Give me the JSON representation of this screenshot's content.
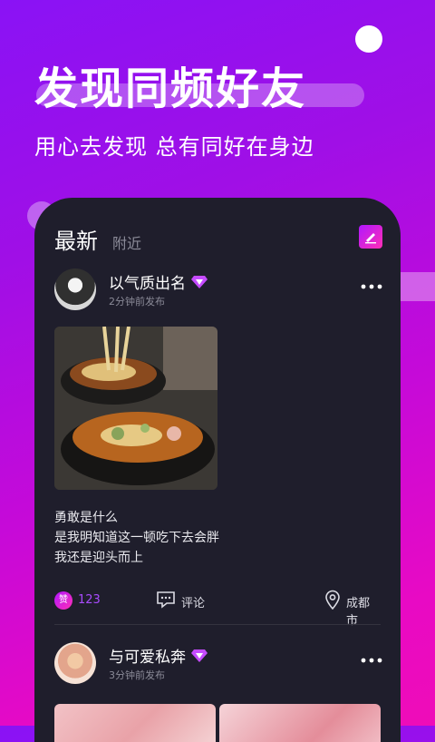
{
  "banner": {
    "headline": "发现同频好友",
    "subline": "用心去发现 总有同好在身边"
  },
  "tabs": [
    {
      "label": "最新",
      "active": true
    },
    {
      "label": "附近",
      "active": false
    }
  ],
  "posts": [
    {
      "username": "以气质出名",
      "time": "2分钟前发布",
      "text": [
        "勇敢是什么",
        "是我明知道这一顿吃下去会胖",
        "我还是迎头而上"
      ],
      "like_badge": "赞",
      "likes": "123",
      "comment_label": "评论",
      "location": "成都市"
    },
    {
      "username": "与可爱私奔",
      "time": "3分钟前发布"
    }
  ],
  "icons": {
    "edit": "edit-icon",
    "vip": "diamond-icon",
    "more": "more-dots-icon",
    "comment": "comment-icon",
    "location": "location-pin-icon"
  },
  "colors": {
    "accent": "#a94bff",
    "card_bg": "#1f1e2c",
    "gradient_start": "#8a12f5",
    "gradient_end": "#ef0cb8"
  }
}
